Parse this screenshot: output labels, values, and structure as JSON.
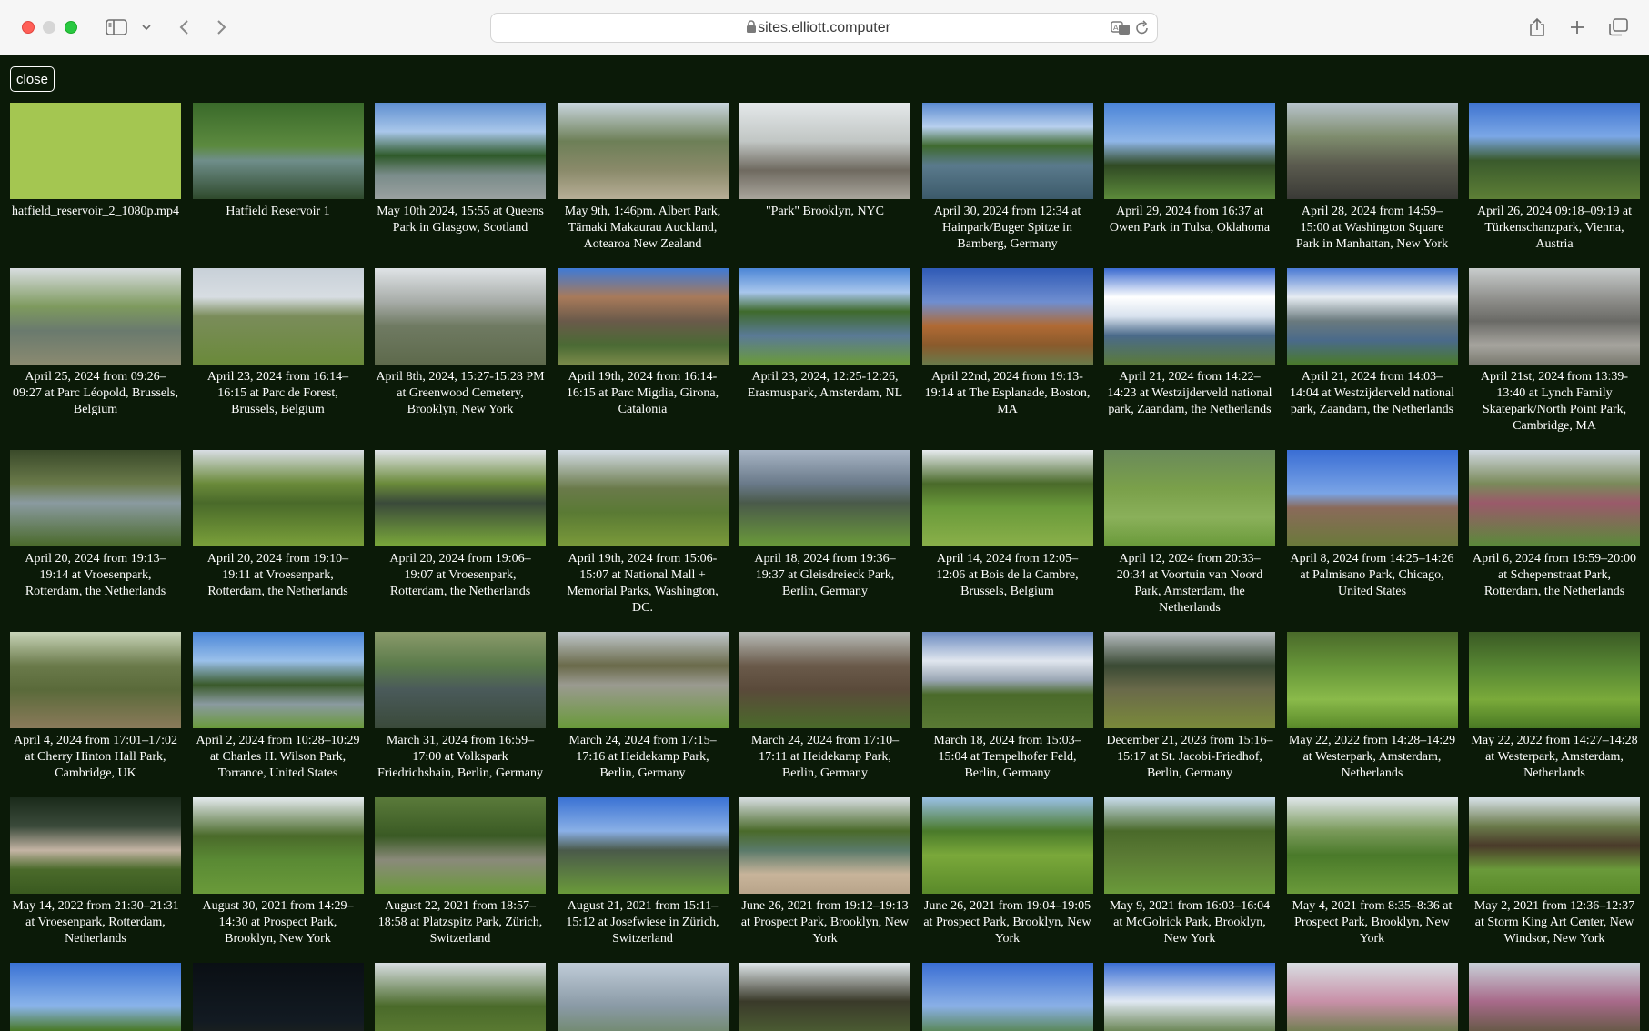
{
  "browser": {
    "url": "sites.elliott.computer"
  },
  "page": {
    "close_label": "close"
  },
  "tiles": [
    {
      "caption": "hatfield_reservoir_2_1080p.mp4",
      "bg": "#a4c651"
    },
    {
      "caption": "Hatfield Reservoir 1",
      "bg": "linear-gradient(180deg,#3a6a2a 0%,#5c8a3f 45%,#6f8e8a 60%,#2f4a2c 100%)"
    },
    {
      "caption": "May 10th 2024, 15:55 at Queens Park in Glasgow, Scotland",
      "bg": "linear-gradient(180deg,#5f8fd0 0%,#a9c7ea 30%,#2f5a2a 55%,#7a8c8a 75%,#9aa1a0 100%)"
    },
    {
      "caption": "May 9th, 1:46pm. Albert Park, Tāmaki Makaurau Auckland, Aotearoa New Zealand",
      "bg": "linear-gradient(180deg,#c9d6de 0%,#6d7f57 40%,#8a8a6a 70%,#b7ae96 100%)"
    },
    {
      "caption": "\"Park\" Brooklyn, NYC",
      "bg": "linear-gradient(180deg,#e4e8ea 0%,#c1c6c4 40%,#6f6a60 70%,#a9a59c 100%)"
    },
    {
      "caption": "April 30, 2024 from 12:34 at Hainpark/Buger Spitze in Bamberg, Germany",
      "bg": "linear-gradient(180deg,#5a8ad0 0%,#b8d0ee 25%,#3f6a2f 45%,#5a7a8c 65%,#3c5a6a 100%)"
    },
    {
      "caption": "April 29, 2024 from 16:37 at Owen Park in Tulsa, Oklahoma",
      "bg": "linear-gradient(180deg,#4a84d8 0%,#8fb6e8 40%,#304a24 65%,#5c8a3a 100%)"
    },
    {
      "caption": "April 28, 2024 from 14:59–15:00 at Washington Square Park in Manhattan, New York",
      "bg": "linear-gradient(180deg,#b8c4cc 0%,#7f8d6e 35%,#5a5a4e 65%,#3a3a36 100%)"
    },
    {
      "caption": "April 26, 2024 09:18–09:19 at Türkenschanzpark, Vienna, Austria",
      "bg": "linear-gradient(180deg,#3f74d0 0%,#7ba7e6 35%,#3a5a2c 60%,#5d7f36 100%)"
    },
    {
      "caption": "April 25, 2024 from 09:26–09:27 at Parc Léopold, Brussels, Belgium",
      "bg": "linear-gradient(180deg,#d8dde0 0%,#7e9a5e 40%,#6a7a6e 65%,#8a8a70 100%)"
    },
    {
      "caption": "April 23, 2024 from 16:14–16:15 at Parc de Forest, Brussels, Belgium",
      "bg": "linear-gradient(180deg,#c8d0d8 0%,#d7dde2 30%,#7a8c5a 50%,#6a8a3a 100%)"
    },
    {
      "caption": "April 8th, 2024, 15:27-15:28 PM at Greenwood Cemetery, Brooklyn, New York",
      "bg": "linear-gradient(180deg,#dfe3e6 0%,#a7aca8 35%,#6f7a62 60%,#5e6a4c 100%)"
    },
    {
      "caption": "April 19th, 2024 from 16:14-16:15 at Parc Migdia, Girona, Catalonia",
      "bg": "linear-gradient(180deg,#3f7ad6 0%,#a87a5a 30%,#6a5a4a 55%,#4a6a34 80%,#7a8a4a 100%)"
    },
    {
      "caption": "April 23, 2024, 12:25-12:26, Erasmuspark, Amsterdam, NL",
      "bg": "linear-gradient(180deg,#4c86d6 0%,#a8c6ec 25%,#3f6a2c 45%,#5a7a96 70%,#6a9a3a 100%)"
    },
    {
      "caption": "April 22nd, 2024 from 19:13-19:14 at The Esplanade, Boston, MA",
      "bg": "linear-gradient(180deg,#2f5ab6 0%,#6f8ed0 35%,#b06a34 60%,#8a5a2c 80%,#6a7a4a 100%)"
    },
    {
      "caption": "April 21, 2024 from 14:22–14:23 at Westzijderveld national park, Zaandam, the Netherlands",
      "bg": "linear-gradient(180deg,#3a6ad0 0%,#ffffff 30%,#d8e2ee 50%,#4a6a8a 70%,#5a7a3a 100%)"
    },
    {
      "caption": "April 21, 2024 from 14:03–14:04 at Westzijderveld national park, Zaandam, the Netherlands",
      "bg": "linear-gradient(180deg,#4a7ad4 0%,#e6ecf2 30%,#6a7a7e 55%,#4a6a8a 75%,#4a7a2a 100%)"
    },
    {
      "caption": "April 21st, 2024 from 13:39-13:40 at Lynch Family Skatepark/North Point Park, Cambridge, MA",
      "bg": "linear-gradient(180deg,#c8cccc 0%,#8a8a86 35%,#6a6a66 55%,#a6a49e 80%,#7a7a70 100%)"
    },
    {
      "caption": "April 20, 2024 from 19:13–19:14 at Vroesenpark, Rotterdam, the Netherlands",
      "bg": "linear-gradient(180deg,#3a4a2a 0%,#6a7a4a 35%,#8a9aa0 55%,#4a6a2a 100%)"
    },
    {
      "caption": "April 20, 2024 from 19:10–19:11 at Vroesenpark, Rotterdam, the Netherlands",
      "bg": "linear-gradient(180deg,#d8dde4 0%,#6a8a3a 35%,#4a6a2a 55%,#7aa03a 100%)"
    },
    {
      "caption": "April 20, 2024 from 19:06–19:07 at Vroesenpark, Rotterdam, the Netherlands",
      "bg": "linear-gradient(180deg,#e0e4e8 0%,#6a8a3a 35%,#3a4a3a 55%,#7aa83a 100%)"
    },
    {
      "caption": "April 19th, 2024 from 15:06-15:07 at National Mall + Memorial Parks, Washington, DC.",
      "bg": "linear-gradient(180deg,#d4dde6 0%,#6a7a4a 40%,#5a7a34 65%,#7a9a3a 100%)"
    },
    {
      "caption": "April 18, 2024 from 19:36–19:37 at Gleisdreieck Park, Berlin, Germany",
      "bg": "linear-gradient(180deg,#a7b4c4 0%,#6a7a8a 35%,#4a5a4a 55%,#6a9a3a 100%)"
    },
    {
      "caption": "April 14, 2024 from 12:05–12:06 at Bois de la Cambre, Brussels, Belgium",
      "bg": "linear-gradient(180deg,#e6eaee 0%,#4a6a2a 35%,#6a9a3a 60%,#8ab04a 100%)"
    },
    {
      "caption": "April 12, 2024 from 20:33–20:34 at Voortuin van Noord Park, Amsterdam, the Netherlands",
      "bg": "linear-gradient(180deg,#6a8a5a 0%,#7aa04a 40%,#8ab05a 70%,#6a9a3a 100%)"
    },
    {
      "caption": "April 8, 2024 from 14:25–14:26 at Palmisano Park, Chicago, United States",
      "bg": "linear-gradient(180deg,#3a6ed4 0%,#7aa4e6 45%,#8a6a5a 60%,#6a7a3a 100%)"
    },
    {
      "caption": "April 6, 2024 from 19:59–20:00 at Schepenstraat Park, Rotterdam, the Netherlands",
      "bg": "linear-gradient(180deg,#d0d8e0 0%,#7a8a5a 35%,#9a5a6a 55%,#5a8a3a 100%)"
    },
    {
      "caption": "April 4, 2024 from 17:01–17:02 at Cherry Hinton Hall Park, Cambridge, UK",
      "bg": "linear-gradient(180deg,#c8d4b8 0%,#6a7a4a 35%,#5a6a3a 60%,#8a7a5a 100%)"
    },
    {
      "caption": "April 2, 2024 from 10:28–10:29 at Charles H. Wilson Park, Torrance, United States",
      "bg": "linear-gradient(180deg,#4a86d8 0%,#9ac0ea 30%,#3a5a2a 55%,#8a9aa0 75%,#6a9a3a 100%)"
    },
    {
      "caption": "March 31, 2024 from 16:59–17:00 at Volkspark Friedrichshain, Berlin, Germany",
      "bg": "linear-gradient(180deg,#8a9a6a 0%,#5a7a4a 35%,#4a5a5a 60%,#3a4a3a 100%)"
    },
    {
      "caption": "March 24, 2024 from 17:15–17:16 at Heidekamp Park, Berlin, Germany",
      "bg": "linear-gradient(180deg,#c0c8cc 0%,#6a6a4a 35%,#9a9a90 55%,#6a9a3a 100%)"
    },
    {
      "caption": "March 24, 2024 from 17:10–17:11 at Heidekamp Park, Berlin, Germany",
      "bg": "linear-gradient(180deg,#b8bcb8 0%,#6a5a4a 35%,#5a4a3a 60%,#4a6a2a 100%)"
    },
    {
      "caption": "March 18, 2024 from 15:03–15:04 at Tempelhofer Feld, Berlin, Germany",
      "bg": "linear-gradient(180deg,#6a8ac0 0%,#e0e6ee 30%,#9aa6b4 50%,#4a6a2a 65%,#5a7a34 100%)"
    },
    {
      "caption": "December 21, 2023 from 15:16–15:17 at St. Jacobi-Friedhof, Berlin, Germany",
      "bg": "linear-gradient(180deg,#b8bec2 0%,#3a4a34 35%,#6a6a4a 60%,#7a8a3a 100%)"
    },
    {
      "caption": "May 22, 2022 from 14:28–14:29 at Westerpark, Amsterdam, Netherlands",
      "bg": "linear-gradient(180deg,#4a6a2a 0%,#6a9a3a 40%,#8aba4a 70%,#5a8a2a 100%)"
    },
    {
      "caption": "May 22, 2022 from 14:27–14:28 at Westerpark, Amsterdam, Netherlands",
      "bg": "linear-gradient(180deg,#3a5a24 0%,#5a8a34 40%,#7aaa3a 70%,#4a7a24 100%)"
    },
    {
      "caption": "May 14, 2022 from 21:30–21:31 at Vroesenpark, Rotterdam, Netherlands",
      "bg": "linear-gradient(180deg,#1a2a1a 0%,#3a4a3a 30%,#c4b4a4 55%,#4a6a2a 75%,#3a5a20 100%)"
    },
    {
      "caption": "August 30, 2021 from 14:29–14:30 at Prospect Park, Brooklyn, New York",
      "bg": "linear-gradient(180deg,#e4eaee 0%,#4a6a2a 40%,#5a8a34 65%,#6a9a3a 100%)"
    },
    {
      "caption": "August 22, 2021 from 18:57–18:58 at Platzspitz Park, Zürich, Switzerland",
      "bg": "linear-gradient(180deg,#5a7a3a 0%,#3a5a24 40%,#8a8a7a 65%,#6a9a3a 100%)"
    },
    {
      "caption": "August 21, 2021 from 15:11–15:12 at Josefwiese in Zürich, Switzerland",
      "bg": "linear-gradient(180deg,#3a72d4 0%,#8ab0e6 35%,#4a5a4a 55%,#6a9a3a 100%)"
    },
    {
      "caption": "June 26, 2021 from 19:12–19:13 at Prospect Park, Brooklyn, New York",
      "bg": "linear-gradient(180deg,#d8dee2 0%,#4a6a2a 35%,#5a7a6a 55%,#c8b49a 80%,#b8a48a 100%)"
    },
    {
      "caption": "June 26, 2021 from 19:04–19:05 at Prospect Park, Brooklyn, New York",
      "bg": "linear-gradient(180deg,#9ac0e6 0%,#4a7a2a 35%,#7aa83a 60%,#5a8a2a 100%)"
    },
    {
      "caption": "May 9, 2021 from 16:03–16:04 at McGolrick Park, Brooklyn, New York",
      "bg": "linear-gradient(180deg,#c8dcec 0%,#4a6a2a 35%,#5a7a34 60%,#6a9a3a 100%)"
    },
    {
      "caption": "May 4, 2021 from 8:35–8:36 at Prospect Park, Brooklyn, New York",
      "bg": "linear-gradient(180deg,#dfe6ea 0%,#7a9a5a 35%,#4a7a2a 60%,#6a9a3a 100%)"
    },
    {
      "caption": "May 2, 2021 from 12:36–12:37 at Storm King Art Center, New Windsor, New York",
      "bg": "linear-gradient(180deg,#d8e2ea 0%,#6a7a4a 30%,#4a3a2a 50%,#6a9a3a 75%,#5a8a2a 100%)"
    },
    {
      "caption": "",
      "bg": "linear-gradient(180deg,#3a72d4 0%,#8ab4ea 45%,#4a7a2a 70%,#5a8a2a 100%)"
    },
    {
      "caption": "",
      "bg": "linear-gradient(180deg,#0a0f14 0%,#121a22 60%,#2a2a1a 100%)"
    },
    {
      "caption": "",
      "bg": "linear-gradient(180deg,#d8dee2 0%,#4a6a2a 45%,#6a8a3a 100%)"
    },
    {
      "caption": "",
      "bg": "linear-gradient(180deg,#c0ccd8 0%,#8a9aa6 45%,#5a7a3a 100%)"
    },
    {
      "caption": "",
      "bg": "linear-gradient(180deg,#dfe6ea 0%,#3a3a2a 40%,#5a7a3a 100%)"
    },
    {
      "caption": "",
      "bg": "linear-gradient(180deg,#3a6ed4 0%,#8ab0e6 45%,#4a7a2a 80%,#5a8a2a 100%)"
    },
    {
      "caption": "",
      "bg": "linear-gradient(180deg,#3a6ed4 0%,#dfe8f2 40%,#4a6a2a 80%,#5a7a2a 100%)"
    },
    {
      "caption": "",
      "bg": "linear-gradient(180deg,#d8dee2 0%,#c890a8 40%,#5a7a3a 80%,#4a6a2a 100%)"
    },
    {
      "caption": "",
      "bg": "linear-gradient(180deg,#c8d0d8 0%,#a86a8a 40%,#6a5a4a 70%,#5a7a3a 100%)"
    }
  ]
}
